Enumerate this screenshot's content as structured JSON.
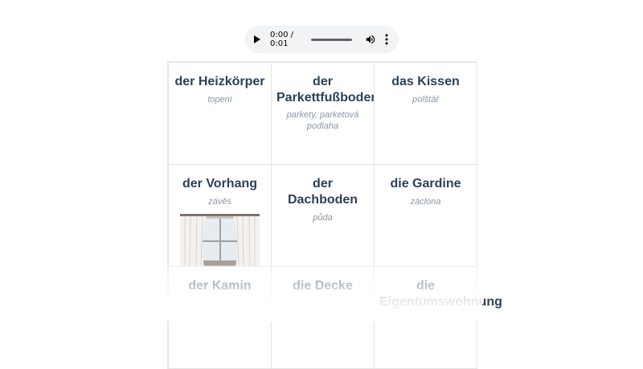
{
  "audio": {
    "time": "0:00 / 0:01",
    "progress": 0
  },
  "cards": [
    {
      "word": "der Heizkörper",
      "translation": "topení"
    },
    {
      "word": "der Parkettfußboden",
      "translation": "parkety, parketová podlaha"
    },
    {
      "word": "das Kissen",
      "translation": "polštář"
    },
    {
      "word": "der Vorhang",
      "translation": "závěs",
      "image": "curtain-photo"
    },
    {
      "word": "der Dachboden",
      "translation": "půda"
    },
    {
      "word": "die Gardine",
      "translation": "záclona"
    },
    {
      "word": "der Kamin",
      "translation": ""
    },
    {
      "word": "die Decke",
      "translation": ""
    },
    {
      "word": "die Eigentumswohnung",
      "translation": ""
    }
  ]
}
